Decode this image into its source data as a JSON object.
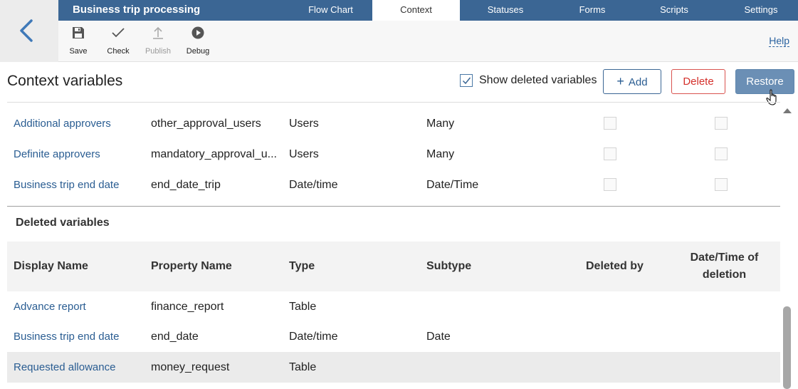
{
  "header": {
    "title": "Business trip processing",
    "tabs": [
      {
        "label": "Flow Chart",
        "active": false
      },
      {
        "label": "Context",
        "active": true
      },
      {
        "label": "Statuses",
        "active": false
      },
      {
        "label": "Forms",
        "active": false
      },
      {
        "label": "Scripts",
        "active": false
      },
      {
        "label": "Settings",
        "active": false
      }
    ]
  },
  "toolbar": {
    "save_label": "Save",
    "check_label": "Check",
    "publish_label": "Publish",
    "debug_label": "Debug",
    "help_label": "Help"
  },
  "context": {
    "title": "Context variables",
    "show_deleted_label": "Show deleted variables",
    "show_deleted_checked": true,
    "add_label": "Add",
    "delete_label": "Delete",
    "restore_label": "Restore"
  },
  "variables": [
    {
      "display_name": "Additional approvers",
      "property_name": "other_approval_users",
      "type": "Users",
      "subtype": "Many"
    },
    {
      "display_name": "Definite approvers",
      "property_name": "mandatory_approval_u...",
      "type": "Users",
      "subtype": "Many"
    },
    {
      "display_name": "Business trip end date",
      "property_name": "end_date_trip",
      "type": "Date/time",
      "subtype": "Date/Time"
    }
  ],
  "deleted": {
    "section_title": "Deleted variables",
    "columns": {
      "display_name": "Display Name",
      "property_name": "Property Name",
      "type": "Type",
      "subtype": "Subtype",
      "deleted_by": "Deleted by",
      "date_time": "Date/Time of deletion"
    },
    "rows": [
      {
        "display_name": "Advance report",
        "property_name": "finance_report",
        "type": "Table",
        "subtype": ""
      },
      {
        "display_name": "Business trip end date",
        "property_name": "end_date",
        "type": "Date/time",
        "subtype": "Date"
      },
      {
        "display_name": "Requested allowance",
        "property_name": "money_request",
        "type": "Table",
        "subtype": ""
      }
    ]
  },
  "colors": {
    "header_bg": "#3b6694",
    "link": "#2a5d92",
    "delete_red": "#d4302b",
    "restore_bg": "#6b8fb5"
  },
  "icons": [
    "back-arrow-icon",
    "save-icon",
    "check-icon",
    "publish-icon",
    "debug-icon",
    "plus-icon",
    "checkbox-checked-icon",
    "hand-pointer-icon",
    "scroll-up-icon"
  ]
}
